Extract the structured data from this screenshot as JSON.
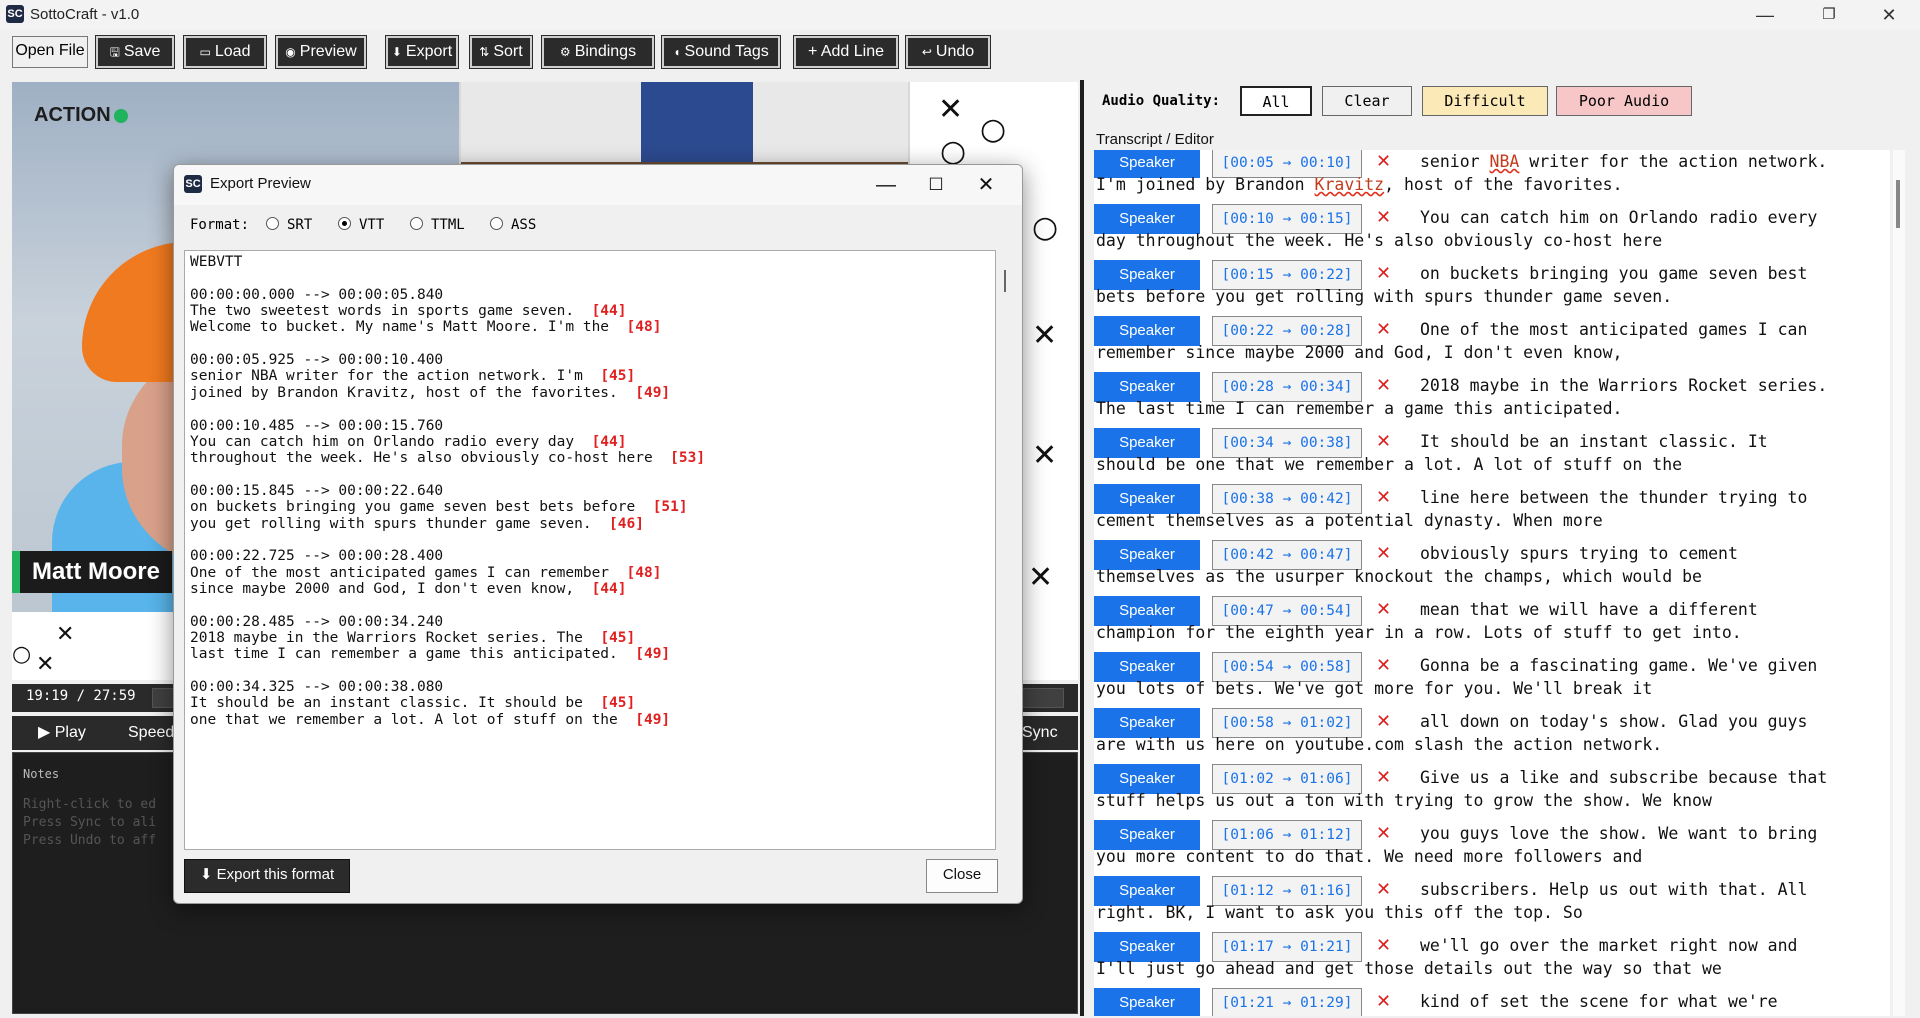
{
  "window": {
    "title": "SottoCraft - v1.0",
    "logo_text": "SC"
  },
  "toolbar": {
    "open_file": "Open File",
    "save": "Save",
    "load": "Load",
    "preview": "Preview",
    "export": "Export",
    "sort": "Sort",
    "bindings": "Bindings",
    "sound_tags": "Sound Tags",
    "add_line": "+ Add Line",
    "undo": "Undo"
  },
  "video": {
    "logo_text": "ACTION",
    "name_tag": "Matt Moore"
  },
  "playback": {
    "timecode": "19:19 / 27:59",
    "play": "Play",
    "speed": "Speed",
    "sync": "Sync"
  },
  "notes": {
    "title": "Notes",
    "hints": [
      "Right-click to ed",
      "Press Sync to ali",
      "Press Undo to aff"
    ]
  },
  "audio_quality": {
    "label": "Audio Quality:",
    "filters": [
      "All",
      "Clear",
      "Difficult",
      "Poor Audio"
    ],
    "colors": {
      "clear": "#f0f0f0",
      "difficult": "#fbe9b7",
      "poor": "#f7c6c6"
    }
  },
  "transcript": {
    "label": "Transcript / Editor",
    "speaker_label": "Speaker",
    "delete_glyph": "✕",
    "lines": [
      {
        "time": "[00:05 → 00:10]",
        "text": "senior NBA writer for the action network.",
        "cont": "I'm joined by Brandon Kravitz, host of the favorites."
      },
      {
        "time": "[00:10 → 00:15]",
        "text": "You can catch him on Orlando radio every",
        "cont": "day throughout the week. He's also obviously co-host here"
      },
      {
        "time": "[00:15 → 00:22]",
        "text": "on buckets bringing you game seven best",
        "cont": "bets before you get rolling with spurs thunder game seven."
      },
      {
        "time": "[00:22 → 00:28]",
        "text": "One of the most anticipated games I can",
        "cont": "remember since maybe 2000 and God, I don't even know,"
      },
      {
        "time": "[00:28 → 00:34]",
        "text": "2018 maybe in the Warriors Rocket series.",
        "cont": "The last time I can remember a game this anticipated."
      },
      {
        "time": "[00:34 → 00:38]",
        "text": "It should be an instant classic. It",
        "cont": "should be one that we remember a lot. A lot of stuff on the"
      },
      {
        "time": "[00:38 → 00:42]",
        "text": "line here between the thunder trying to",
        "cont": "cement themselves as a potential dynasty. When more"
      },
      {
        "time": "[00:42 → 00:47]",
        "text": "obviously spurs trying to cement",
        "cont": "themselves as the usurper knockout the champs, which would be"
      },
      {
        "time": "[00:47 → 00:54]",
        "text": "mean that we will have a different",
        "cont": "champion for the eighth year in a row. Lots of stuff to get into."
      },
      {
        "time": "[00:54 → 00:58]",
        "text": "Gonna be a fascinating game. We've given",
        "cont": "you lots of bets. We've got more for you. We'll break it"
      },
      {
        "time": "[00:58 → 01:02]",
        "text": "all down on today's show. Glad you guys",
        "cont": "are with us here on youtube.com slash the action network."
      },
      {
        "time": "[01:02 → 01:06]",
        "text": "Give us a like and subscribe because that",
        "cont": "stuff helps us out a ton with trying to grow the show. We know"
      },
      {
        "time": "[01:06 → 01:12]",
        "text": "you guys love the show. We want to bring",
        "cont": "you more content to do that. We need more followers and"
      },
      {
        "time": "[01:12 → 01:16]",
        "text": "subscribers. Help us out with that. All",
        "cont": "right. BK, I want to ask you this off the top. So"
      },
      {
        "time": "[01:17 → 01:21]",
        "text": "we'll go over the market right now and",
        "cont": "I'll just go ahead and get those details out the way so that we"
      },
      {
        "time": "[01:21 → 01:29]",
        "text": "kind of set the scene for what we're",
        "cont": ""
      }
    ]
  },
  "export_dialog": {
    "title": "Export Preview",
    "format_label": "Format:",
    "formats": [
      "SRT",
      "VTT",
      "TTML",
      "ASS"
    ],
    "selected_format": "VTT",
    "header": "WEBVTT",
    "cues": [
      {
        "timing": "00:00:00.000 --> 00:00:05.840",
        "lines": [
          {
            "text": "The two sweetest words in sports game seven.",
            "count": "[44]"
          },
          {
            "text": "Welcome to bucket. My name's Matt Moore. I'm the",
            "count": "[48]"
          }
        ]
      },
      {
        "timing": "00:00:05.925 --> 00:00:10.400",
        "lines": [
          {
            "text": "senior NBA writer for the action network. I'm",
            "count": "[45]"
          },
          {
            "text": "joined by Brandon Kravitz, host of the favorites.",
            "count": "[49]"
          }
        ]
      },
      {
        "timing": "00:00:10.485 --> 00:00:15.760",
        "lines": [
          {
            "text": "You can catch him on Orlando radio every day",
            "count": "[44]"
          },
          {
            "text": "throughout the week. He's also obviously co-host here",
            "count": "[53]"
          }
        ]
      },
      {
        "timing": "00:00:15.845 --> 00:00:22.640",
        "lines": [
          {
            "text": "on buckets bringing you game seven best bets before",
            "count": "[51]"
          },
          {
            "text": "you get rolling with spurs thunder game seven.",
            "count": "[46]"
          }
        ]
      },
      {
        "timing": "00:00:22.725 --> 00:00:28.400",
        "lines": [
          {
            "text": "One of the most anticipated games I can remember",
            "count": "[48]"
          },
          {
            "text": "since maybe 2000 and God, I don't even know,",
            "count": "[44]"
          }
        ]
      },
      {
        "timing": "00:00:28.485 --> 00:00:34.240",
        "lines": [
          {
            "text": "2018 maybe in the Warriors Rocket series. The",
            "count": "[45]"
          },
          {
            "text": "last time I can remember a game this anticipated.",
            "count": "[49]"
          }
        ]
      },
      {
        "timing": "00:00:34.325 --> 00:00:38.080",
        "lines": [
          {
            "text": "It should be an instant classic. It should be",
            "count": "[45]"
          },
          {
            "text": "one that we remember a lot. A lot of stuff on the",
            "count": "[49]"
          }
        ]
      }
    ],
    "export_button": "Export this format",
    "close_button": "Close"
  }
}
